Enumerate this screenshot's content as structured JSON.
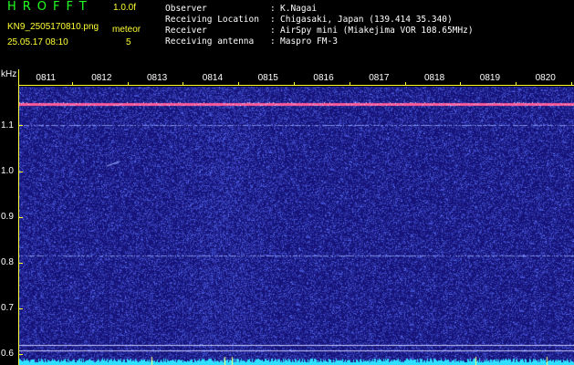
{
  "header": {
    "app_title": "HROFFT",
    "version": "1.0.0f",
    "filename": "KN9_2505170810.png",
    "timestamp": "25.05.17 08:10",
    "mode_label": "meteor",
    "mode_value": "5",
    "fields": [
      {
        "label": "Observer",
        "value": "K.Nagai"
      },
      {
        "label": "Receiving Location",
        "value": "Chigasaki, Japan (139.414 35.340)"
      },
      {
        "label": "Receiver",
        "value": "AirSpy mini (Miakejima VOR 108.65MHz)"
      },
      {
        "label": "Receiving antenna",
        "value": "Maspro FM-3"
      }
    ]
  },
  "spectrogram": {
    "y_unit": "kHz",
    "y_ticks": [
      "1.1",
      "1.0",
      "0.9",
      "0.8",
      "0.7",
      "0.6"
    ],
    "x_ticks": [
      "0811",
      "0812",
      "0813",
      "0814",
      "0815",
      "0816",
      "0817",
      "0818",
      "0819",
      "0820"
    ],
    "y_range": [
      0.575,
      1.185
    ],
    "steady_lines_khz": [
      1.148,
      1.101,
      0.815,
      0.62,
      0.608
    ],
    "colors": {
      "background": "#16147a",
      "noise": "#4a5ae0",
      "carrier": "#ff5a9a",
      "baseline": "#30e0ff",
      "axis": "#ffff33",
      "title": "#22ff22"
    }
  }
}
